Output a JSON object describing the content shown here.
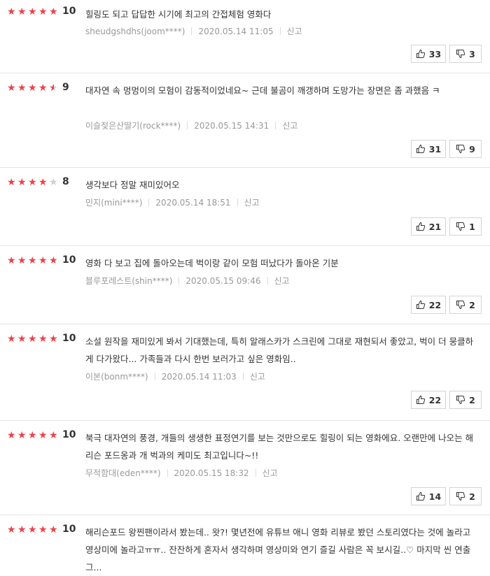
{
  "reviews": [
    {
      "stars": 5,
      "score": "10",
      "text": "힐링도 되고 답답한 시기에 최고의 간접체험 영화다",
      "user": "sheudgshdhs(joom****)",
      "date": "2020.05.14 11:05",
      "report": "신고",
      "likes": "33",
      "dislikes": "3"
    },
    {
      "stars": 4.5,
      "score": "9",
      "text": "대자연 속 멍멍이의 모험이 감동적이었네요~ 근데 불곰이 깨갱하며 도망가는 장면은 좀 과했음 ㅋ",
      "user": "이슬젖은산딸기(rock****)",
      "date": "2020.05.15 14:31",
      "report": "신고",
      "likes": "31",
      "dislikes": "9"
    },
    {
      "stars": 4,
      "score": "8",
      "text": "생각보다 정말 재미있어오",
      "user": "민지(mini****)",
      "date": "2020.05.14 18:51",
      "report": "신고",
      "likes": "21",
      "dislikes": "1"
    },
    {
      "stars": 5,
      "score": "10",
      "text": "영화 다 보고 집에 돌아오는데 벅이랑 같이 모험 떠났다가 돌아온 기분",
      "user": "블루포레스트(shin****)",
      "date": "2020.05.15 09:46",
      "report": "신고",
      "likes": "22",
      "dislikes": "2"
    },
    {
      "stars": 5,
      "score": "10",
      "text": "소설 원작을 재미있게 봐서 기대했는데, 특히 알래스카가 스크린에 그대로 재현되서 좋았고, 벅이 더 뭉클하게 다가왔다... 가족들과 다시 한번 보러가고 싶은 영화임..",
      "user": "이본(bonm****)",
      "date": "2020.05.14 11:03",
      "report": "신고",
      "likes": "22",
      "dislikes": "2"
    },
    {
      "stars": 5,
      "score": "10",
      "text": "북극 대자연의 풍경, 개들의 생생한 표정연기를 보는 것만으로도 힐링이 되는 영화에요. 오랜만에 나오는 해리슨 포드옹과 개 벅과의 케미도 최고입니다~!!",
      "user": "무적함대(eden****)",
      "date": "2020.05.15 18:32",
      "report": "신고",
      "likes": "14",
      "dislikes": "2"
    },
    {
      "stars": 5,
      "score": "10",
      "text": "해리슨포드 왕찐팬이라서 봤는데.. 왓?! 몇년전에 유튜브 애니 영화 리뷰로 봤던 스토리였다는 것에 놀라고 영상미에 놀라고ㅠㅠ.. 잔잔하게 혼자서 생각하며 영상미와 연기 즐길 사람은 꼭 보시길..♡ 마지막 씬 연출 그..."
    }
  ]
}
